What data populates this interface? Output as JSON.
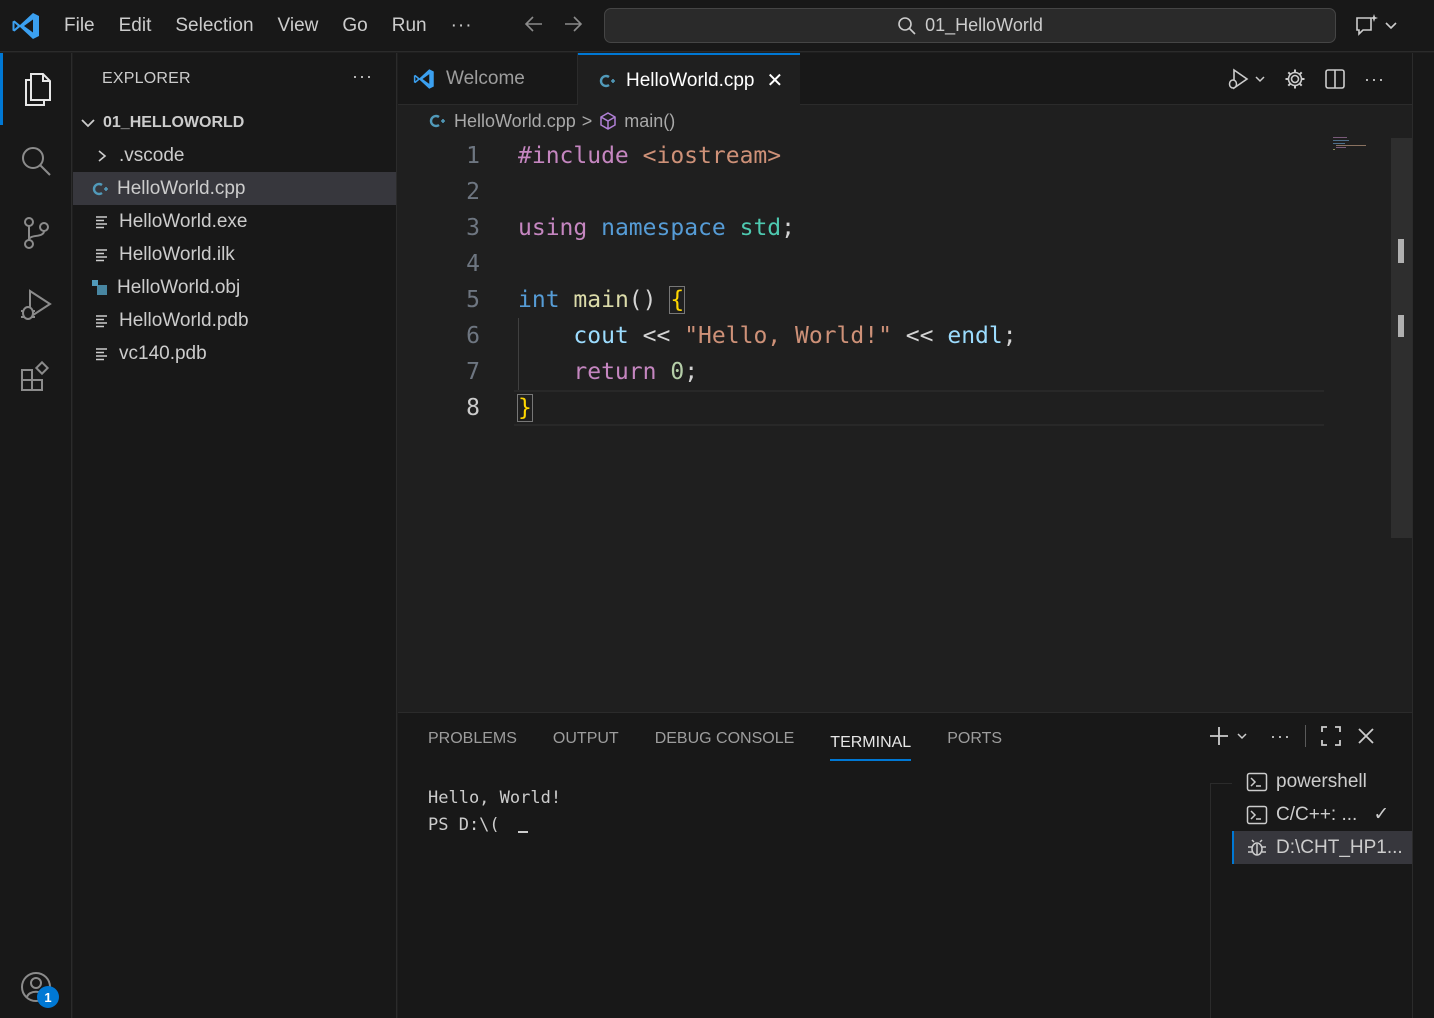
{
  "menu": {
    "file": "File",
    "edit": "Edit",
    "selection": "Selection",
    "view": "View",
    "go": "Go",
    "run": "Run",
    "more": "···"
  },
  "command_center": {
    "text": "01_HelloWorld"
  },
  "explorer": {
    "title": "EXPLORER",
    "more": "···",
    "folder": "01_HELLOWORLD",
    "items": [
      {
        "label": ".vscode",
        "icon": "chevron-right-icon"
      },
      {
        "label": "HelloWorld.cpp",
        "icon": "cpp-file-icon"
      },
      {
        "label": "HelloWorld.exe",
        "icon": "text-file-icon"
      },
      {
        "label": "HelloWorld.ilk",
        "icon": "text-file-icon"
      },
      {
        "label": "HelloWorld.obj",
        "icon": "object-file-icon"
      },
      {
        "label": "HelloWorld.pdb",
        "icon": "text-file-icon"
      },
      {
        "label": "vc140.pdb",
        "icon": "text-file-icon"
      }
    ]
  },
  "activity": {
    "badge_count": "1"
  },
  "tabs": {
    "welcome": "Welcome",
    "active": "HelloWorld.cpp",
    "close": "✕"
  },
  "breadcrumbs": {
    "file": "HelloWorld.cpp",
    "sep": ">",
    "symbol": "main()"
  },
  "code": {
    "line_numbers": [
      "1",
      "2",
      "3",
      "4",
      "5",
      "6",
      "7",
      "8"
    ],
    "l1_directive": "#include",
    "l1_header": "<iostream>",
    "l3_using": "using",
    "l3_namespace": "namespace",
    "l3_std": "std",
    "l3_semi": ";",
    "l5_int": "int",
    "l5_main": "main",
    "l5_parens": "()",
    "l5_brace": "{",
    "l6_cout": "cout",
    "l6_op1": "<<",
    "l6_str": "\"Hello, World!\"",
    "l6_op2": "<<",
    "l6_endl": "endl",
    "l6_semi": ";",
    "l7_return": "return",
    "l7_num": "0",
    "l7_semi": ";",
    "l8_brace": "}"
  },
  "panel": {
    "tabs": [
      "PROBLEMS",
      "OUTPUT",
      "DEBUG CONSOLE",
      "TERMINAL",
      "PORTS"
    ],
    "active_tab": "TERMINAL",
    "terminal_lines": [
      "Hello, World!",
      "PS D:\\("
    ],
    "terminals": [
      {
        "label": "powershell",
        "icon": "terminal-icon"
      },
      {
        "label": "C/C++: ...",
        "icon": "terminal-icon",
        "status": "✓"
      },
      {
        "label": "D:\\CHT_HP1...",
        "icon": "debug-icon"
      }
    ]
  },
  "colors": {
    "accent": "#0078d4",
    "background": "#1f1f1f",
    "sidebar": "#181818"
  }
}
